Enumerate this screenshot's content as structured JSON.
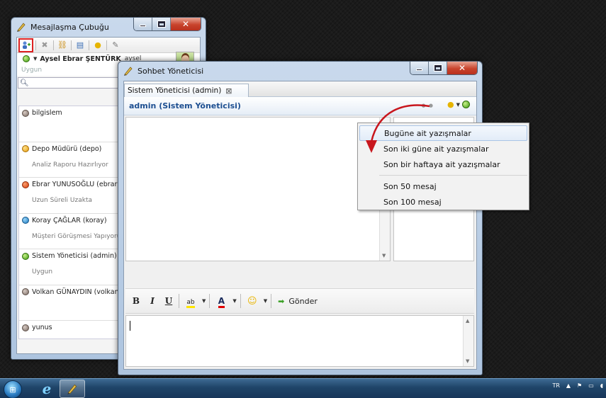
{
  "messaging_bar": {
    "title": "Mesajlaşma Çubuğu",
    "current_user": {
      "name": "Aysel Ebrar ŞENTÜRK",
      "login": "aysel",
      "status": "Uygun"
    },
    "contacts": [
      {
        "name": "bilgislem",
        "status_text": "",
        "status_color": "gray"
      },
      {
        "name": "Depo Müdürü (depo)",
        "status_text": "Analiz Raporu Hazırlıyor",
        "status_color": "orange"
      },
      {
        "name": "Ebrar YUNUSOĞLU (ebrar)",
        "status_text": "Uzun Süreli Uzakta",
        "status_color": "red"
      },
      {
        "name": "Koray ÇAĞLAR (koray)",
        "status_text": "Müşteri Görüşmesi Yapıyorum",
        "status_color": "blue"
      },
      {
        "name": "Sistem Yöneticisi (admin)",
        "status_text": "Uygun",
        "status_color": "green"
      },
      {
        "name": "Volkan GÜNAYDIN (volkan)",
        "status_text": "",
        "status_color": "gray"
      },
      {
        "name": "yunus",
        "status_text": "",
        "status_color": "gray"
      }
    ]
  },
  "chat_manager": {
    "title": "Sohbet Yöneticisi",
    "tab_label": "Sistem Yöneticisi (admin)",
    "conversation_title": "admin (Sistem Yöneticisi)",
    "send_label": "Gönder",
    "format_buttons": {
      "bold": "B",
      "italic": "I",
      "underline": "U",
      "highlight": "ab",
      "font_color": "A"
    }
  },
  "history_menu": {
    "items": [
      "Bugüne ait yazışmalar",
      "Son iki güne ait yazışmalar",
      "Son bir haftaya ait yazışmalar",
      "Son 50 mesaj",
      "Son 100 mesaj"
    ],
    "highlighted_index": 0
  },
  "taskbar": {
    "language": "TR"
  },
  "colors": {
    "accent_title": "#1d4f91",
    "annotation_arrow": "#c8161d"
  }
}
